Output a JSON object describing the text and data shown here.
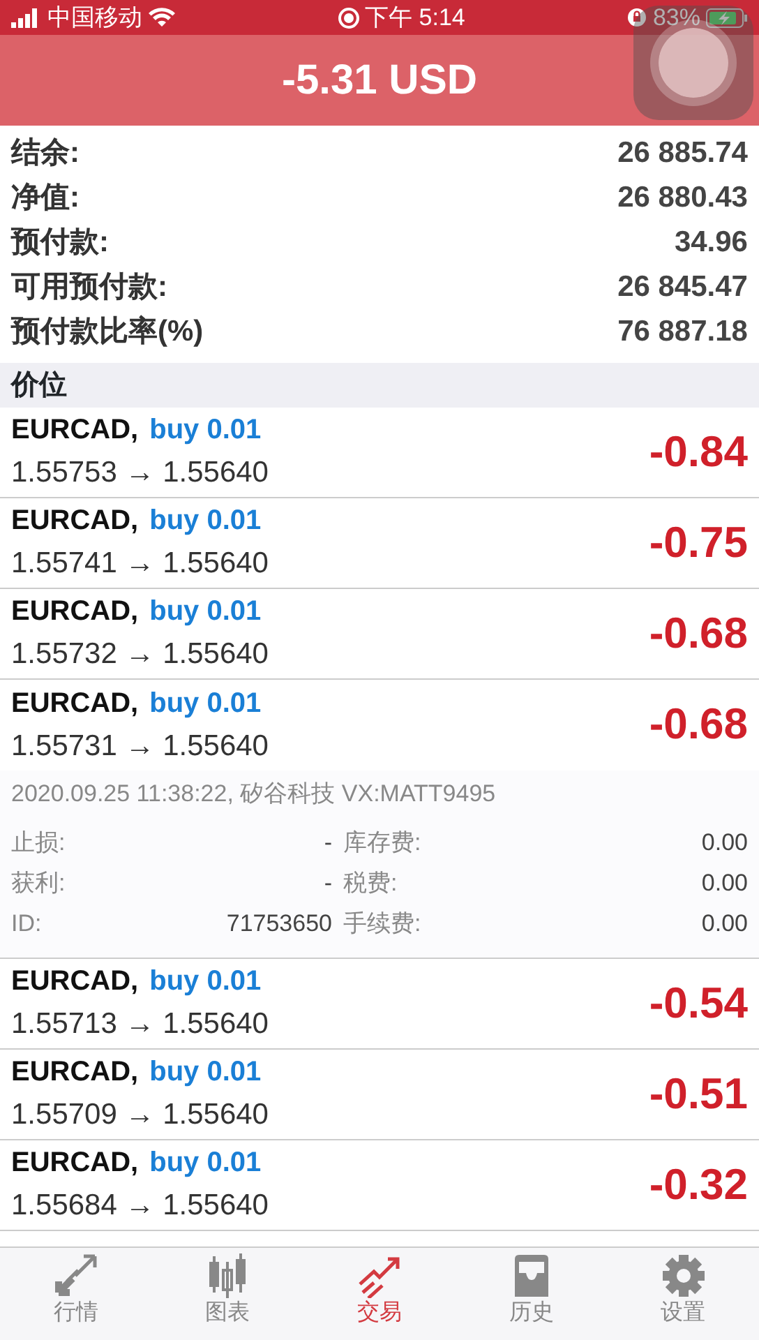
{
  "status_bar": {
    "carrier": "中国移动",
    "time": "下午 5:14",
    "battery": "83%"
  },
  "header": {
    "title": "-5.31 USD"
  },
  "summary": [
    {
      "label": "结余:",
      "value": "26 885.74"
    },
    {
      "label": "净值:",
      "value": "26 880.43"
    },
    {
      "label": "预付款:",
      "value": "34.96"
    },
    {
      "label": "可用预付款:",
      "value": "26 845.47"
    },
    {
      "label": "预付款比率(%)",
      "value": "76 887.18"
    }
  ],
  "section": {
    "title": "价位"
  },
  "positions": [
    {
      "symbol": "EURCAD,",
      "side": "buy 0.01",
      "prices": "1.55753 → 1.55640",
      "profit": "-0.84",
      "expanded": false
    },
    {
      "symbol": "EURCAD,",
      "side": "buy 0.01",
      "prices": "1.55741 → 1.55640",
      "profit": "-0.75",
      "expanded": false
    },
    {
      "symbol": "EURCAD,",
      "side": "buy 0.01",
      "prices": "1.55732 → 1.55640",
      "profit": "-0.68",
      "expanded": false
    },
    {
      "symbol": "EURCAD,",
      "side": "buy 0.01",
      "prices": "1.55731 → 1.55640",
      "profit": "-0.68",
      "expanded": true,
      "details": {
        "opened": "2020.09.25 11:38:22, 矽谷科技 VX:MATT9495",
        "fields": [
          {
            "label": "止损:",
            "value": "-",
            "label2": "库存费:",
            "value2": "0.00"
          },
          {
            "label": "获利:",
            "value": "-",
            "label2": "税费:",
            "value2": "0.00"
          },
          {
            "label": "ID:",
            "value": "71753650",
            "label2": "手续费:",
            "value2": "0.00"
          }
        ]
      }
    },
    {
      "symbol": "EURCAD,",
      "side": "buy 0.01",
      "prices": "1.55713 → 1.55640",
      "profit": "-0.54",
      "expanded": false
    },
    {
      "symbol": "EURCAD,",
      "side": "buy 0.01",
      "prices": "1.55709 → 1.55640",
      "profit": "-0.51",
      "expanded": false
    },
    {
      "symbol": "EURCAD,",
      "side": "buy 0.01",
      "prices": "1.55684 → 1.55640",
      "profit": "-0.32",
      "expanded": false
    }
  ],
  "tab_bar": [
    {
      "label": "行情",
      "selected": false
    },
    {
      "label": "图表",
      "selected": false
    },
    {
      "label": "交易",
      "selected": true
    },
    {
      "label": "历史",
      "selected": false
    },
    {
      "label": "设置",
      "selected": false
    }
  ]
}
